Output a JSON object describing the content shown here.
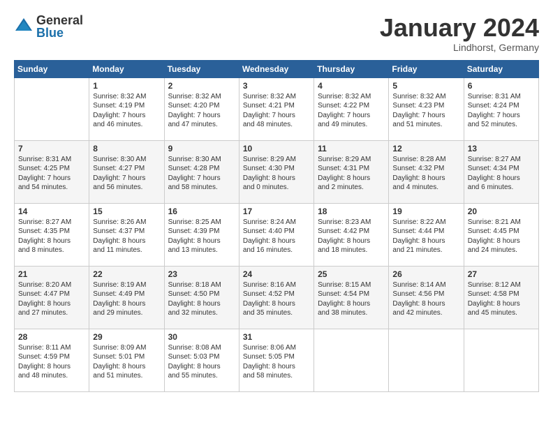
{
  "logo": {
    "general": "General",
    "blue": "Blue"
  },
  "title": "January 2024",
  "location": "Lindhorst, Germany",
  "days_header": [
    "Sunday",
    "Monday",
    "Tuesday",
    "Wednesday",
    "Thursday",
    "Friday",
    "Saturday"
  ],
  "weeks": [
    [
      {
        "day": "",
        "info": ""
      },
      {
        "day": "1",
        "info": "Sunrise: 8:32 AM\nSunset: 4:19 PM\nDaylight: 7 hours\nand 46 minutes."
      },
      {
        "day": "2",
        "info": "Sunrise: 8:32 AM\nSunset: 4:20 PM\nDaylight: 7 hours\nand 47 minutes."
      },
      {
        "day": "3",
        "info": "Sunrise: 8:32 AM\nSunset: 4:21 PM\nDaylight: 7 hours\nand 48 minutes."
      },
      {
        "day": "4",
        "info": "Sunrise: 8:32 AM\nSunset: 4:22 PM\nDaylight: 7 hours\nand 49 minutes."
      },
      {
        "day": "5",
        "info": "Sunrise: 8:32 AM\nSunset: 4:23 PM\nDaylight: 7 hours\nand 51 minutes."
      },
      {
        "day": "6",
        "info": "Sunrise: 8:31 AM\nSunset: 4:24 PM\nDaylight: 7 hours\nand 52 minutes."
      }
    ],
    [
      {
        "day": "7",
        "info": "Sunrise: 8:31 AM\nSunset: 4:25 PM\nDaylight: 7 hours\nand 54 minutes."
      },
      {
        "day": "8",
        "info": "Sunrise: 8:30 AM\nSunset: 4:27 PM\nDaylight: 7 hours\nand 56 minutes."
      },
      {
        "day": "9",
        "info": "Sunrise: 8:30 AM\nSunset: 4:28 PM\nDaylight: 7 hours\nand 58 minutes."
      },
      {
        "day": "10",
        "info": "Sunrise: 8:29 AM\nSunset: 4:30 PM\nDaylight: 8 hours\nand 0 minutes."
      },
      {
        "day": "11",
        "info": "Sunrise: 8:29 AM\nSunset: 4:31 PM\nDaylight: 8 hours\nand 2 minutes."
      },
      {
        "day": "12",
        "info": "Sunrise: 8:28 AM\nSunset: 4:32 PM\nDaylight: 8 hours\nand 4 minutes."
      },
      {
        "day": "13",
        "info": "Sunrise: 8:27 AM\nSunset: 4:34 PM\nDaylight: 8 hours\nand 6 minutes."
      }
    ],
    [
      {
        "day": "14",
        "info": "Sunrise: 8:27 AM\nSunset: 4:35 PM\nDaylight: 8 hours\nand 8 minutes."
      },
      {
        "day": "15",
        "info": "Sunrise: 8:26 AM\nSunset: 4:37 PM\nDaylight: 8 hours\nand 11 minutes."
      },
      {
        "day": "16",
        "info": "Sunrise: 8:25 AM\nSunset: 4:39 PM\nDaylight: 8 hours\nand 13 minutes."
      },
      {
        "day": "17",
        "info": "Sunrise: 8:24 AM\nSunset: 4:40 PM\nDaylight: 8 hours\nand 16 minutes."
      },
      {
        "day": "18",
        "info": "Sunrise: 8:23 AM\nSunset: 4:42 PM\nDaylight: 8 hours\nand 18 minutes."
      },
      {
        "day": "19",
        "info": "Sunrise: 8:22 AM\nSunset: 4:44 PM\nDaylight: 8 hours\nand 21 minutes."
      },
      {
        "day": "20",
        "info": "Sunrise: 8:21 AM\nSunset: 4:45 PM\nDaylight: 8 hours\nand 24 minutes."
      }
    ],
    [
      {
        "day": "21",
        "info": "Sunrise: 8:20 AM\nSunset: 4:47 PM\nDaylight: 8 hours\nand 27 minutes."
      },
      {
        "day": "22",
        "info": "Sunrise: 8:19 AM\nSunset: 4:49 PM\nDaylight: 8 hours\nand 29 minutes."
      },
      {
        "day": "23",
        "info": "Sunrise: 8:18 AM\nSunset: 4:50 PM\nDaylight: 8 hours\nand 32 minutes."
      },
      {
        "day": "24",
        "info": "Sunrise: 8:16 AM\nSunset: 4:52 PM\nDaylight: 8 hours\nand 35 minutes."
      },
      {
        "day": "25",
        "info": "Sunrise: 8:15 AM\nSunset: 4:54 PM\nDaylight: 8 hours\nand 38 minutes."
      },
      {
        "day": "26",
        "info": "Sunrise: 8:14 AM\nSunset: 4:56 PM\nDaylight: 8 hours\nand 42 minutes."
      },
      {
        "day": "27",
        "info": "Sunrise: 8:12 AM\nSunset: 4:58 PM\nDaylight: 8 hours\nand 45 minutes."
      }
    ],
    [
      {
        "day": "28",
        "info": "Sunrise: 8:11 AM\nSunset: 4:59 PM\nDaylight: 8 hours\nand 48 minutes."
      },
      {
        "day": "29",
        "info": "Sunrise: 8:09 AM\nSunset: 5:01 PM\nDaylight: 8 hours\nand 51 minutes."
      },
      {
        "day": "30",
        "info": "Sunrise: 8:08 AM\nSunset: 5:03 PM\nDaylight: 8 hours\nand 55 minutes."
      },
      {
        "day": "31",
        "info": "Sunrise: 8:06 AM\nSunset: 5:05 PM\nDaylight: 8 hours\nand 58 minutes."
      },
      {
        "day": "",
        "info": ""
      },
      {
        "day": "",
        "info": ""
      },
      {
        "day": "",
        "info": ""
      }
    ]
  ]
}
